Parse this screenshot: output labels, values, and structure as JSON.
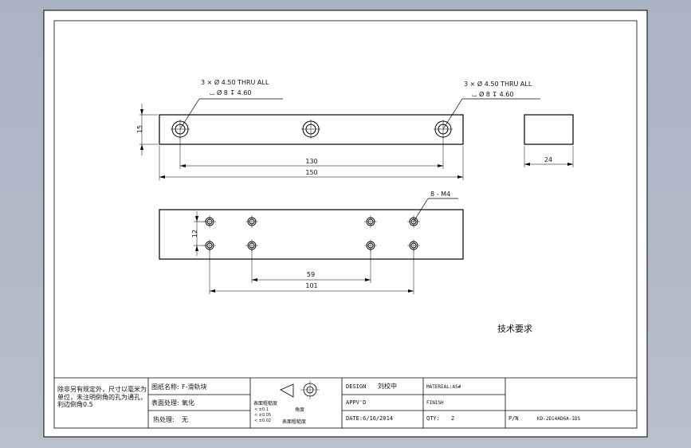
{
  "callouts": {
    "hole_left": {
      "line1": "3 × Ø 4.50 THRU ALL",
      "line2": "⌴ Ø 8 ↧ 4.60"
    },
    "hole_right": {
      "line1": "3 × Ø 4.50 THRU ALL",
      "line2": "⌴ Ø 8 ↧ 4.60"
    },
    "thread": "8 - M4"
  },
  "dimensions": {
    "height_15": "15",
    "spacing_130": "130",
    "length_150": "150",
    "width_24": "24",
    "row_12": "12",
    "spacing_59": "59",
    "spacing_101": "101"
  },
  "tech_requirements": "技术要求",
  "title_block": {
    "note": "除非另有规定外，尺寸以毫米为单位，未注明倒角的孔为通孔，利边倒角0.5",
    "part_name_label": "图纸名称:",
    "part_name_value": "F-滑轨块",
    "surface_label": "表面处理:",
    "surface_value": "氧化",
    "heat_label": "热处理:",
    "heat_value": "无",
    "roughness_label": "表面粗糙度",
    "roughness_values": [
      "< ±0.1",
      "< ±0.05",
      "< ±0.02"
    ],
    "flatness_label": "角度",
    "tolerance_footer": "表面粗糙度",
    "design_label": "DESIGN",
    "design_value": "刘校中",
    "material_label": "MATERIAL:AS#",
    "appvd_label": "APPV'D",
    "finish_label": "FINISH",
    "date_label": "DATE:6/16/2014",
    "qty_label": "QTY:",
    "qty_value": "2",
    "pn_label": "P/N",
    "pn_value": "KD-2D14AD6A-IDS"
  }
}
